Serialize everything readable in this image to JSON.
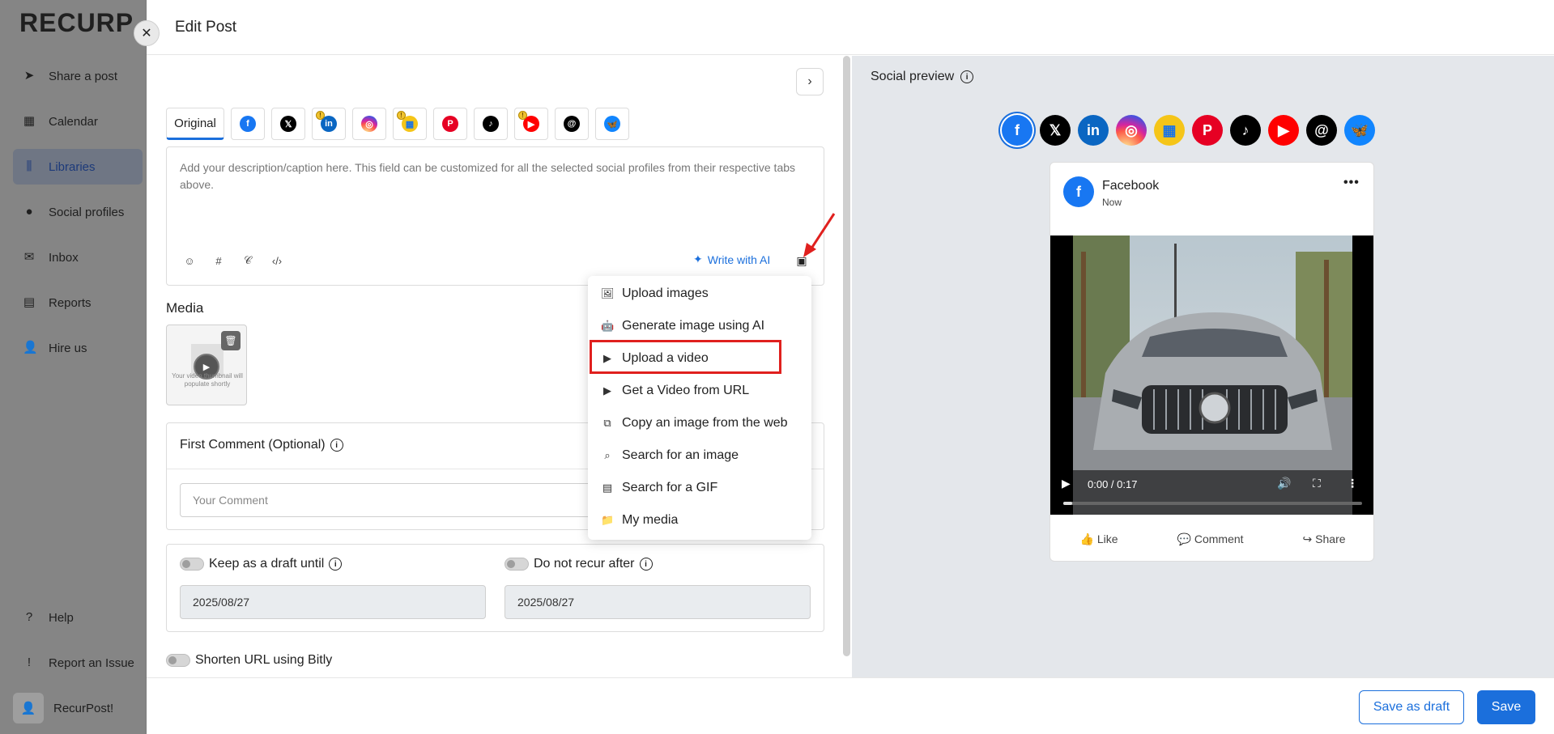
{
  "app": {
    "logo_text": "RECURP",
    "nav": [
      {
        "label": "Share a post",
        "icon": "send-icon"
      },
      {
        "label": "Calendar",
        "icon": "calendar-icon"
      },
      {
        "label": "Libraries",
        "icon": "libraries-icon",
        "active": true
      },
      {
        "label": "Social profiles",
        "icon": "profile-icon"
      },
      {
        "label": "Inbox",
        "icon": "inbox-icon"
      },
      {
        "label": "Reports",
        "icon": "reports-icon"
      },
      {
        "label": "Hire us",
        "icon": "person-icon"
      }
    ],
    "bottom_nav": [
      {
        "label": "Help",
        "icon": "help-icon"
      },
      {
        "label": "Report an Issue",
        "icon": "report-issue-icon"
      }
    ],
    "user_name": "RecurPost!"
  },
  "modal": {
    "title": "Edit Post",
    "close_icon": "close-icon",
    "tabs": {
      "original_label": "Original",
      "networks": [
        {
          "name": "facebook",
          "glyph": "f",
          "warn": false
        },
        {
          "name": "x",
          "glyph": "𝕏",
          "warn": false
        },
        {
          "name": "linkedin",
          "glyph": "in",
          "warn": true
        },
        {
          "name": "instagram",
          "glyph": "◎",
          "warn": false
        },
        {
          "name": "google-business",
          "glyph": "▦",
          "warn": true
        },
        {
          "name": "pinterest",
          "glyph": "P",
          "warn": false
        },
        {
          "name": "tiktok",
          "glyph": "♪",
          "warn": false
        },
        {
          "name": "youtube",
          "glyph": "▶",
          "warn": true
        },
        {
          "name": "threads",
          "glyph": "@",
          "warn": false
        },
        {
          "name": "bluesky",
          "glyph": "🦋",
          "warn": false
        }
      ]
    },
    "caption": {
      "placeholder": "Add your description/caption here. This field can be customized for all the selected social profiles from their respective tabs above.",
      "write_ai_label": "Write with AI"
    },
    "media": {
      "label": "Media",
      "thumb_text": "Your video thumbnail will populate shortly"
    },
    "first_comment": {
      "title": "First Comment (Optional)",
      "placeholder": "Your Comment"
    },
    "draft": {
      "keep_label": "Keep as a draft until",
      "keep_date": "2025/08/27",
      "recur_label": "Do not recur after",
      "recur_date": "2025/08/27"
    },
    "bitly_label": "Shorten URL using Bitly",
    "dropdown": [
      {
        "label": "Upload images",
        "icon": "images-icon"
      },
      {
        "label": "Generate image using AI",
        "icon": "robot-icon"
      },
      {
        "label": "Upload a video",
        "icon": "video-icon"
      },
      {
        "label": "Get a Video from URL",
        "icon": "video-url-icon"
      },
      {
        "label": "Copy an image from the web",
        "icon": "copy-icon"
      },
      {
        "label": "Search for an image",
        "icon": "image-search-icon"
      },
      {
        "label": "Search for a GIF",
        "icon": "gif-icon"
      },
      {
        "label": "My media",
        "icon": "folder-icon"
      }
    ],
    "preview": {
      "title": "Social preview",
      "page_name": "Facebook",
      "time": "Now",
      "video_time": "0:00 / 0:17",
      "video_progress": 0.03,
      "actions": {
        "like": "Like",
        "comment": "Comment",
        "share": "Share"
      }
    },
    "footer": {
      "save_draft_label": "Save as draft",
      "save_label": "Save"
    }
  }
}
